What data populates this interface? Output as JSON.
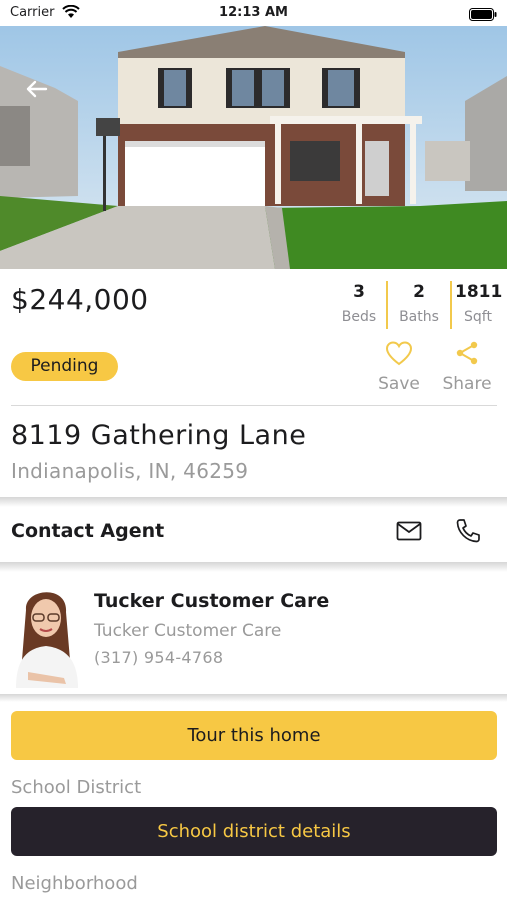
{
  "status_bar": {
    "carrier": "Carrier",
    "time": "12:13 AM"
  },
  "listing": {
    "price": "$244,000",
    "stats": [
      {
        "value": "3",
        "label": "Beds"
      },
      {
        "value": "2",
        "label": "Baths"
      },
      {
        "value": "1811",
        "label": "Sqft"
      }
    ],
    "status": "Pending",
    "actions": {
      "save_label": "Save",
      "share_label": "Share"
    },
    "address": {
      "street": "8119  Gathering Lane",
      "city": "Indianapolis, IN, 46259"
    }
  },
  "contact": {
    "title": "Contact Agent",
    "agent": {
      "name": "Tucker Customer Care",
      "company": "Tucker Customer Care",
      "phone": "(317) 954-4768"
    }
  },
  "buttons": {
    "tour": "Tour this home",
    "school_details": "School district details"
  },
  "sections": {
    "school_district": "School District",
    "neighborhood": "Neighborhood"
  },
  "colors": {
    "accent": "#f7c844",
    "dark": "#26222b",
    "muted": "#9a9a9a"
  }
}
